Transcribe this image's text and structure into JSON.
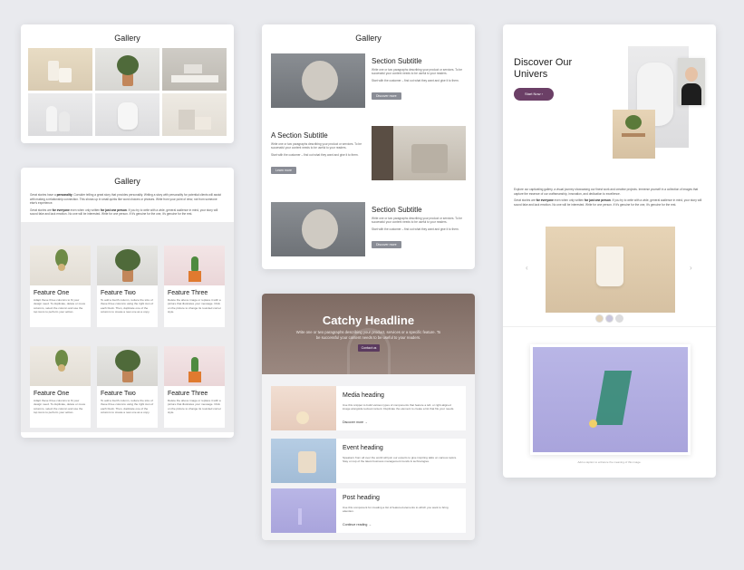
{
  "card1": {
    "title": "Gallery"
  },
  "card2": {
    "title": "Gallery",
    "para1_a": "Great stories have a ",
    "para1_b": "personality",
    "para1_c": ". Consider telling a great story that provides personality. Writing a story with personality for potential clients will assist with making a relationship connection. This shows up in small quirks like word choices or phrases. Write from your point of view, not from someone else's experience.",
    "para2_a": "Great stories are ",
    "para2_b": "for everyone",
    "para2_c": " even when only written ",
    "para2_d": "for just one person",
    "para2_e": ". If you try to write with a wide, general audience in mind, your story will sound fake and lack emotion. No one will be interested. Write for one person. If it's genuine for the one, it's genuine for the rest.",
    "features_row1": [
      {
        "title": "Feature One",
        "desc": "Adapt these three columns to fit your design need. To duplicate, delete or move columns, select the column and use the top icons to perform your action."
      },
      {
        "title": "Feature Two",
        "desc": "To add a fourth column, reduce the size of these three columns using the right icon of each block. Then, duplicate one of the columns to create a new one as a copy."
      },
      {
        "title": "Feature Three",
        "desc": "Delete the above image or replace it with a picture that illustrates your message. Click on the picture to change its rounded corner style."
      }
    ],
    "features_row2": [
      {
        "title": "Feature One",
        "desc": "Adapt these three columns to fit your design need. To duplicate, delete or move columns, select the column and use the top icons to perform your action."
      },
      {
        "title": "Feature Two",
        "desc": "To add a fourth column, reduce the size of these three columns using the right icon of each block. Then, duplicate one of the columns to create a new one as a copy."
      },
      {
        "title": "Feature Three",
        "desc": "Delete the above image or replace it with a picture that illustrates your message. Click on the picture to change its rounded corner style."
      }
    ]
  },
  "card3": {
    "title": "Gallery",
    "sections": [
      {
        "title": "Section Subtitle",
        "desc1": "Write one or two paragraphs describing your product or services. To be successful your content needs to be useful to your readers.",
        "desc2": "Start with the customer – find out what they want and give it to them.",
        "button": "Discover more"
      },
      {
        "title": "A Section Subtitle",
        "desc1": "Write one or two paragraphs describing your product or services. To be successful your content needs to be useful to your readers.",
        "desc2": "Start with the customer – find out what they want and give it to them.",
        "button": "Learn more"
      },
      {
        "title": "Section Subtitle",
        "desc1": "Write one or two paragraphs describing your product or services. To be successful your content needs to be useful to your readers.",
        "desc2": "Start with the customer – find out what they want and give it to them.",
        "button": "Discover more"
      }
    ]
  },
  "card4": {
    "headline": "Catchy Headline",
    "sub": "Write one or two paragraphs describing your product, services or a specific feature. To be successful your content needs to be useful to your readers.",
    "button": "Contact us",
    "items": [
      {
        "title": "Media heading",
        "desc": "Use this snippet to build various types of components that feature a left- or right-aligned image alongside textual content. Duplicate the element to create a list that fits your needs.",
        "link": "Discover more  →"
      },
      {
        "title": "Event heading",
        "desc": "Speakers from all over the world will join our experts to give inspiring talks on various topics. Stay on top of the latest business management trends & technologies.",
        "link": ""
      },
      {
        "title": "Post heading",
        "desc": "Use this component for creating a list of featured elements to which you want to bring attention.",
        "link": "Continue reading  →"
      }
    ]
  },
  "card5": {
    "headline": "Discover Our Univers",
    "button": "Start Now  ›",
    "para1": "Explore our captivating gallery, a visual journey showcasing our finest work and creative projects. Immerse yourself in a collection of images that capture the essence of our craftsmanship, innovation, and dedication to excellence.",
    "para2_a": "Great stories are ",
    "para2_b": "for everyone",
    "para2_c": " even when only written ",
    "para2_d": "for just one person",
    "para2_e": ". If you try to write with a wide, general audience in mind, your story will sound fake and lack emotion. No one will be interested. Write for one person. If it's genuine for the one, it's genuine for the rest.",
    "arrow_left": "‹",
    "arrow_right": "›",
    "caption": "Add a caption to enhance the meaning of this image."
  }
}
